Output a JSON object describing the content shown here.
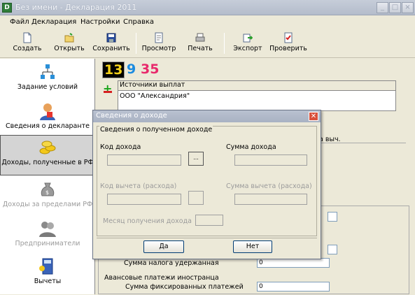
{
  "window": {
    "title": "Без имени - Декларация 2011",
    "app_icon_letter": "D"
  },
  "menu": [
    "Файл",
    "Декларация",
    "Настройки",
    "Справка"
  ],
  "toolbar": {
    "create": "Создать",
    "open": "Открыть",
    "save": "Сохранить",
    "preview": "Просмотр",
    "print": "Печать",
    "export": "Экспорт",
    "check": "Проверить"
  },
  "sidebar": {
    "items": [
      {
        "label": "Задание условий",
        "icon": "tree-icon"
      },
      {
        "label": "Сведения о декларанте",
        "icon": "person-icon"
      },
      {
        "label": "Доходы, полученные в РФ",
        "icon": "coins-icon"
      },
      {
        "label": "Доходы за пределами РФ",
        "icon": "money-bag-icon"
      },
      {
        "label": "Предприниматели",
        "icon": "people-icon"
      },
      {
        "label": "Вычеты",
        "icon": "calculator-icon"
      }
    ]
  },
  "main": {
    "rates": [
      "13",
      "9",
      "35"
    ],
    "grid": {
      "header": "Источники выплат",
      "rows": [
        "ООО \"Александрия\""
      ]
    },
    "hidden_header_fragment": "а выч.",
    "tax_withheld_label": "Сумма налога удержанная",
    "tax_withheld_value": "0",
    "advance_section_title": "Авансовые платежи иностранца",
    "fixed_payments_label": "Сумма фиксированных платежей",
    "fixed_payments_value": "0"
  },
  "dialog": {
    "title": "Сведения о доходе",
    "group_title": "Сведения о полученном доходе",
    "income_code_label": "Код дохода",
    "income_sum_label": "Сумма дохода",
    "deduction_code_label": "Код вычета (расхода)",
    "deduction_sum_label": "Сумма вычета (расхода)",
    "month_label": "Месяц получения дохода",
    "yes": "Да",
    "no": "Нет",
    "close": "✕",
    "browse": "..."
  }
}
